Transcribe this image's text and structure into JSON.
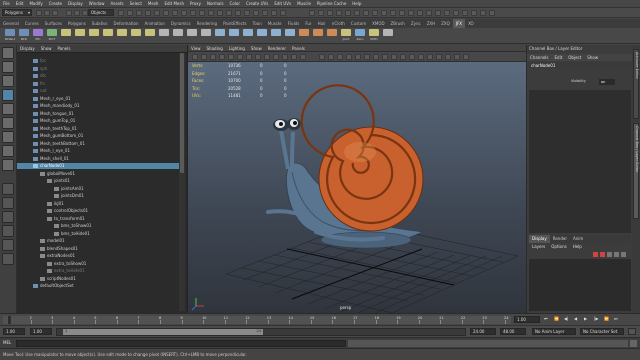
{
  "menubar": {
    "items": [
      "File",
      "Edit",
      "Modify",
      "Create",
      "Display",
      "Window",
      "Assets",
      "Select",
      "Mesh",
      "Edit Mesh",
      "Proxy",
      "Normals",
      "Color",
      "Create UVs",
      "Edit UVs",
      "Muscle",
      "Pipeline Cache",
      "Help"
    ]
  },
  "statusline": {
    "menuset": "Polygons",
    "selection_mode": "Objects"
  },
  "shelf": {
    "tabs": [
      "General",
      "Curves",
      "Surfaces",
      "Polygons",
      "Subdivs",
      "Deformation",
      "Animation",
      "Dynamics",
      "Rendering",
      "PaintEffects",
      "Toon",
      "Muscle",
      "Fluids",
      "Fur",
      "Hair",
      "nCloth",
      "Custom",
      "XMOD",
      "ZBrush",
      "Zync",
      "ZXH",
      "ZXQ",
      "JFX",
      "XO"
    ],
    "active_tab": "JFX",
    "buttons": [
      {
        "label": "Bkt&Lt",
        "icon": "bucket-icon",
        "color": "#6f8fb5"
      },
      {
        "label": "BkD",
        "icon": "bucket-icon",
        "color": "#6f8fb5"
      },
      {
        "label": "Pth",
        "icon": "path-icon",
        "color": "#9a7ad1"
      },
      {
        "label": "PntT",
        "icon": "paint-icon",
        "color": "#7ab27a"
      },
      {
        "label": "",
        "icon": "joint-icon",
        "color": "#c9c27a"
      },
      {
        "label": "",
        "icon": "joint-icon",
        "color": "#c9c27a"
      },
      {
        "label": "",
        "icon": "joint-icon",
        "color": "#c9c27a"
      },
      {
        "label": "",
        "icon": "ik-icon",
        "color": "#c9c27a"
      },
      {
        "label": "",
        "icon": "ik-icon",
        "color": "#c9c27a"
      },
      {
        "label": "",
        "icon": "ik-icon",
        "color": "#c9c27a"
      },
      {
        "label": "",
        "icon": "ik-icon",
        "color": "#c9c27a"
      },
      {
        "label": "",
        "icon": "cluster-icon",
        "color": "#b5b5b5"
      },
      {
        "label": "",
        "icon": "cluster-icon",
        "color": "#b5b5b5"
      },
      {
        "label": "",
        "icon": "cluster-icon",
        "color": "#b5b5b5"
      },
      {
        "label": "",
        "icon": "cluster-icon",
        "color": "#b5b5b5"
      },
      {
        "label": "",
        "icon": "constraint-icon",
        "color": "#8fb1cf"
      },
      {
        "label": "",
        "icon": "constraint-icon",
        "color": "#8fb1cf"
      },
      {
        "label": "",
        "icon": "constraint-icon",
        "color": "#8fb1cf"
      },
      {
        "label": "",
        "icon": "constraint-icon",
        "color": "#8fb1cf"
      },
      {
        "label": "",
        "icon": "constraint-icon",
        "color": "#8fb1cf"
      },
      {
        "label": "",
        "icon": "constraint-icon",
        "color": "#8fb1cf"
      },
      {
        "label": "",
        "icon": "curve-icon",
        "color": "#d08a5a"
      },
      {
        "label": "",
        "icon": "curve-icon",
        "color": "#d08a5a"
      },
      {
        "label": "",
        "icon": "curve-icon",
        "color": "#d08a5a"
      },
      {
        "label": "Joint",
        "icon": "joint-icon",
        "color": "#c9c27a"
      },
      {
        "label": "Zero",
        "icon": "zero-icon",
        "color": "#7aa7d1"
      },
      {
        "label": "IKHD",
        "icon": "ik-icon",
        "color": "#c9c27a"
      },
      {
        "label": "",
        "icon": "misc-icon",
        "color": "#b5b5b5"
      }
    ]
  },
  "outliner": {
    "menu": [
      "Display",
      "Show",
      "Panels"
    ],
    "rows": [
      {
        "label": "fpc",
        "indent": 0,
        "state": "dim"
      },
      {
        "label": "sph",
        "indent": 0,
        "state": "dim"
      },
      {
        "label": "dtc",
        "indent": 0,
        "state": "dim"
      },
      {
        "label": "frs",
        "indent": 0,
        "state": "dim"
      },
      {
        "label": "nat",
        "indent": 0,
        "state": "dim"
      },
      {
        "label": "Mesh_r_eye_01",
        "indent": 0,
        "state": "normal"
      },
      {
        "label": "Mesh_mandiody_01",
        "indent": 0,
        "state": "normal"
      },
      {
        "label": "Mesh_tongue_01",
        "indent": 0,
        "state": "normal"
      },
      {
        "label": "Mesh_gumTop_01",
        "indent": 0,
        "state": "normal"
      },
      {
        "label": "Mesh_teethTop_01",
        "indent": 0,
        "state": "normal"
      },
      {
        "label": "Mesh_gumBottom_01",
        "indent": 0,
        "state": "normal"
      },
      {
        "label": "Mesh_teethBottom_01",
        "indent": 0,
        "state": "normal"
      },
      {
        "label": "Mesh_l_eye_01",
        "indent": 0,
        "state": "normal"
      },
      {
        "label": "Mesh_shell_01",
        "indent": 0,
        "state": "normal"
      },
      {
        "label": "charNode01",
        "indent": 0,
        "state": "selected"
      },
      {
        "label": "globalMove01",
        "indent": 1,
        "state": "normal"
      },
      {
        "label": "joints01",
        "indent": 2,
        "state": "normal"
      },
      {
        "label": "jointsAm01",
        "indent": 3,
        "state": "normal"
      },
      {
        "label": "jointsDm01",
        "indent": 3,
        "state": "normal"
      },
      {
        "label": "ikJ01",
        "indent": 2,
        "state": "normal"
      },
      {
        "label": "controlObjects01",
        "indent": 2,
        "state": "normal"
      },
      {
        "label": "to_transform01",
        "indent": 2,
        "state": "normal"
      },
      {
        "label": "bms_toShow01",
        "indent": 3,
        "state": "normal"
      },
      {
        "label": "bms_toHide01",
        "indent": 3,
        "state": "normal"
      },
      {
        "label": "model01",
        "indent": 1,
        "state": "normal"
      },
      {
        "label": "blendShapes01",
        "indent": 1,
        "state": "normal"
      },
      {
        "label": "extraNodes01",
        "indent": 1,
        "state": "normal"
      },
      {
        "label": "extra_toShow01",
        "indent": 2,
        "state": "normal"
      },
      {
        "label": "extra_toHide01",
        "indent": 2,
        "state": "dim"
      },
      {
        "label": "scriptNodes01",
        "indent": 1,
        "state": "normal"
      },
      {
        "label": "defaultObjectSet",
        "indent": 0,
        "state": "normal"
      }
    ]
  },
  "viewport": {
    "menu": [
      "View",
      "Shading",
      "Lighting",
      "Show",
      "Renderer",
      "Panels"
    ],
    "hud": [
      {
        "label": "Verts:",
        "a": "10736",
        "b": "0",
        "c": "0"
      },
      {
        "label": "Edges:",
        "a": "21671",
        "b": "0",
        "c": "0"
      },
      {
        "label": "Faces:",
        "a": "10700",
        "b": "0",
        "c": "0"
      },
      {
        "label": "Tris:",
        "a": "20528",
        "b": "0",
        "c": "0"
      },
      {
        "label": "UVs:",
        "a": "11481",
        "b": "0",
        "c": "0"
      }
    ],
    "camera": "persp"
  },
  "channelbox": {
    "title": "Channel Box / Layer Editor",
    "menu": [
      "Channels",
      "Edit",
      "Object",
      "Show"
    ],
    "node": "charNode01",
    "visibility_label": "Visibility",
    "visibility_value": "on",
    "layer_tabs": [
      "Display",
      "Render",
      "Anim"
    ],
    "layer_menu": [
      "Layers",
      "Options",
      "Help"
    ]
  },
  "sidetabs": [
    "Attribute Editor",
    "Channel Box / Layer Editor"
  ],
  "timeslider": {
    "ticks": [
      "1",
      "2",
      "3",
      "4",
      "5",
      "6",
      "7",
      "8",
      "9",
      "10",
      "11",
      "12",
      "13",
      "14",
      "15",
      "16",
      "17",
      "18",
      "19",
      "20",
      "21",
      "22",
      "23",
      "24"
    ],
    "current_frame": "1.00"
  },
  "rangeslider": {
    "start_time": "1.00",
    "range_start": "1.00",
    "range_start_marker": "1",
    "range_end_marker": "24",
    "range_end": "24.00",
    "end_time": "48.00",
    "anim_layer": "No Anim Layer",
    "char_set": "No Character Set"
  },
  "cmdline": {
    "lang": "MEL"
  },
  "helpline": {
    "text": "Move Tool: Use manipulator to move object(s). Use edit mode to change pivot (INSERT). Ctrl+LMB to move perpendicular."
  },
  "colors": {
    "selection": "#5285a6",
    "shell": "#c8612e",
    "body": "#5a7590",
    "hud_label": "#f0d36c",
    "viewport_top": "#5b6b7e"
  }
}
